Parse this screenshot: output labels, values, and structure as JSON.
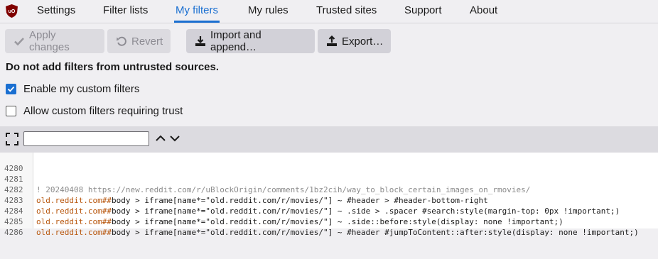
{
  "tabs": [
    {
      "label": "Settings"
    },
    {
      "label": "Filter lists"
    },
    {
      "label": "My filters"
    },
    {
      "label": "My rules"
    },
    {
      "label": "Trusted sites"
    },
    {
      "label": "Support"
    },
    {
      "label": "About"
    }
  ],
  "active_tab": "My filters",
  "toolbar": {
    "apply_label": "Apply changes",
    "revert_label": "Revert",
    "import_label": "Import and append…",
    "export_label": "Export…"
  },
  "warning": "Do not add filters from untrusted sources.",
  "options": {
    "enable_custom": {
      "label": "Enable my custom filters",
      "checked": true
    },
    "allow_trust": {
      "label": "Allow custom filters requiring trust",
      "checked": false
    }
  },
  "search": {
    "value": ""
  },
  "colors": {
    "accent": "#1a6fd1",
    "domain": "#b8570e",
    "comment": "#8b8b8b",
    "logo": "#800000"
  },
  "editor": {
    "lines": [
      {
        "num": "4280",
        "comment": "",
        "domain": "",
        "sep": "",
        "rest": ""
      },
      {
        "num": "4281",
        "comment": "! 20240408 https://new.reddit.com/r/uBlockOrigin/comments/1bz2cih/way_to_block_certain_images_on_rmovies/",
        "domain": "",
        "sep": "",
        "rest": ""
      },
      {
        "num": "4282",
        "comment": "",
        "domain": "old.reddit.com",
        "sep": "##",
        "rest": "body > iframe[name*=\"old.reddit.com/r/movies/\"] ~ #header > #header-bottom-right"
      },
      {
        "num": "4283",
        "comment": "",
        "domain": "old.reddit.com",
        "sep": "##",
        "rest": "body > iframe[name*=\"old.reddit.com/r/movies/\"] ~ .side > .spacer #search:style(margin-top: 0px !important;)"
      },
      {
        "num": "4284",
        "comment": "",
        "domain": "old.reddit.com",
        "sep": "##",
        "rest": "body > iframe[name*=\"old.reddit.com/r/movies/\"] ~ .side::before:style(display: none !important;)"
      },
      {
        "num": "4285",
        "comment": "",
        "domain": "old.reddit.com",
        "sep": "##",
        "rest": "body > iframe[name*=\"old.reddit.com/r/movies/\"] ~ #header #jumpToContent::after:style(display: none !important;)"
      },
      {
        "num": "4286",
        "comment": "",
        "domain": "",
        "sep": "",
        "rest": ""
      }
    ]
  }
}
